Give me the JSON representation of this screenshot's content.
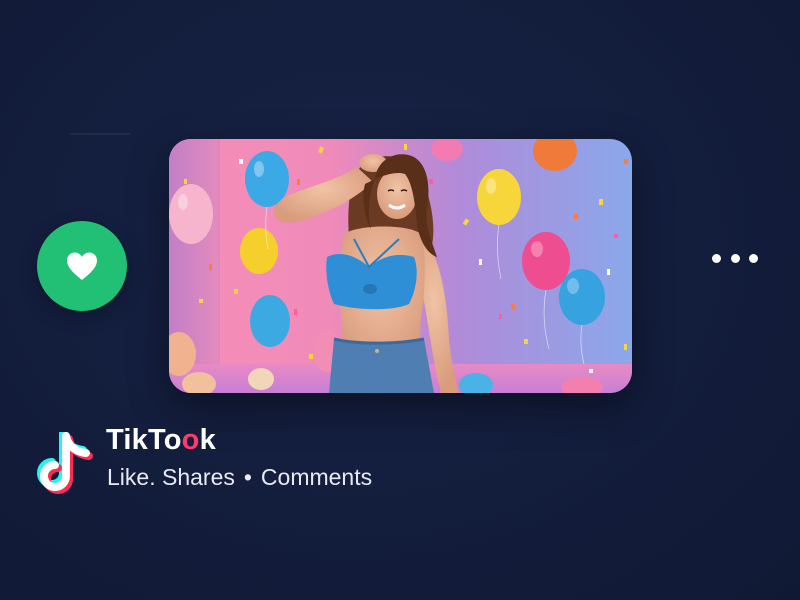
{
  "app": {
    "name_part1": "TikTo",
    "name_accent": "o",
    "name_part2": "k",
    "stats": {
      "like_label": "Like.",
      "shares_label": "Shares",
      "separator": "•",
      "comments_label": "Comments"
    }
  },
  "actions": {
    "like_icon": "heart-icon",
    "more_icon": "more-horizontal-icon"
  },
  "colors": {
    "background": "#131d3c",
    "like_green": "#22c074",
    "accent_pink": "#ff3b6b",
    "accent_cyan": "#25f4ee"
  }
}
